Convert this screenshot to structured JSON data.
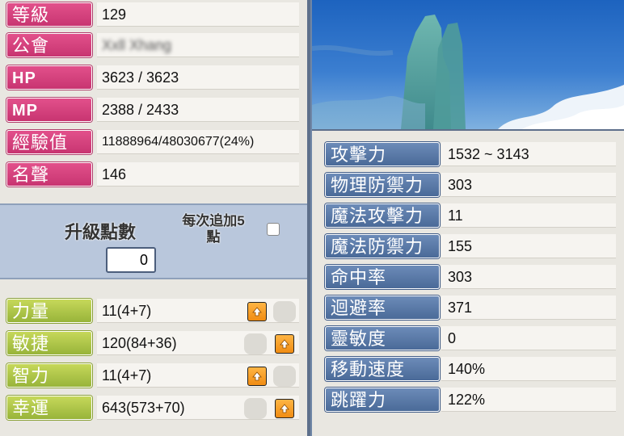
{
  "character_info": {
    "level": {
      "label": "等級",
      "value": "129"
    },
    "guild": {
      "label": "公會",
      "value": "Xxll Xhang"
    },
    "hp": {
      "label": "HP",
      "value": "3623 / 3623"
    },
    "mp": {
      "label": "MP",
      "value": "2388 / 2433"
    },
    "exp": {
      "label": "經驗值",
      "value": "11888964/48030677(24%)"
    },
    "fame": {
      "label": "名聲",
      "value": "146"
    }
  },
  "ability_points": {
    "label": "升級點數",
    "value": "0",
    "add5_label_line1": "每次追加5",
    "add5_label_line2": "點"
  },
  "stats": [
    {
      "label": "力量",
      "value": "11(4+7)"
    },
    {
      "label": "敏捷",
      "value": "120(84+36)"
    },
    {
      "label": "智力",
      "value": "11(4+7)"
    },
    {
      "label": "幸運",
      "value": "643(573+70)"
    }
  ],
  "attributes": [
    {
      "label": "攻擊力",
      "value": "1532 ~ 3143"
    },
    {
      "label": "物理防禦力",
      "value": "303"
    },
    {
      "label": "魔法攻擊力",
      "value": "11"
    },
    {
      "label": "魔法防禦力",
      "value": "155"
    },
    {
      "label": "命中率",
      "value": "303"
    },
    {
      "label": "迴避率",
      "value": "371"
    },
    {
      "label": "靈敏度",
      "value": "0"
    },
    {
      "label": "移動速度",
      "value": "140%"
    },
    {
      "label": "跳躍力",
      "value": "122%"
    }
  ],
  "colors": {
    "info_label": "#d5437d",
    "stat_label": "#b1c84a",
    "attr_label": "#5a7aaa",
    "up_button": "#f7a02a"
  }
}
